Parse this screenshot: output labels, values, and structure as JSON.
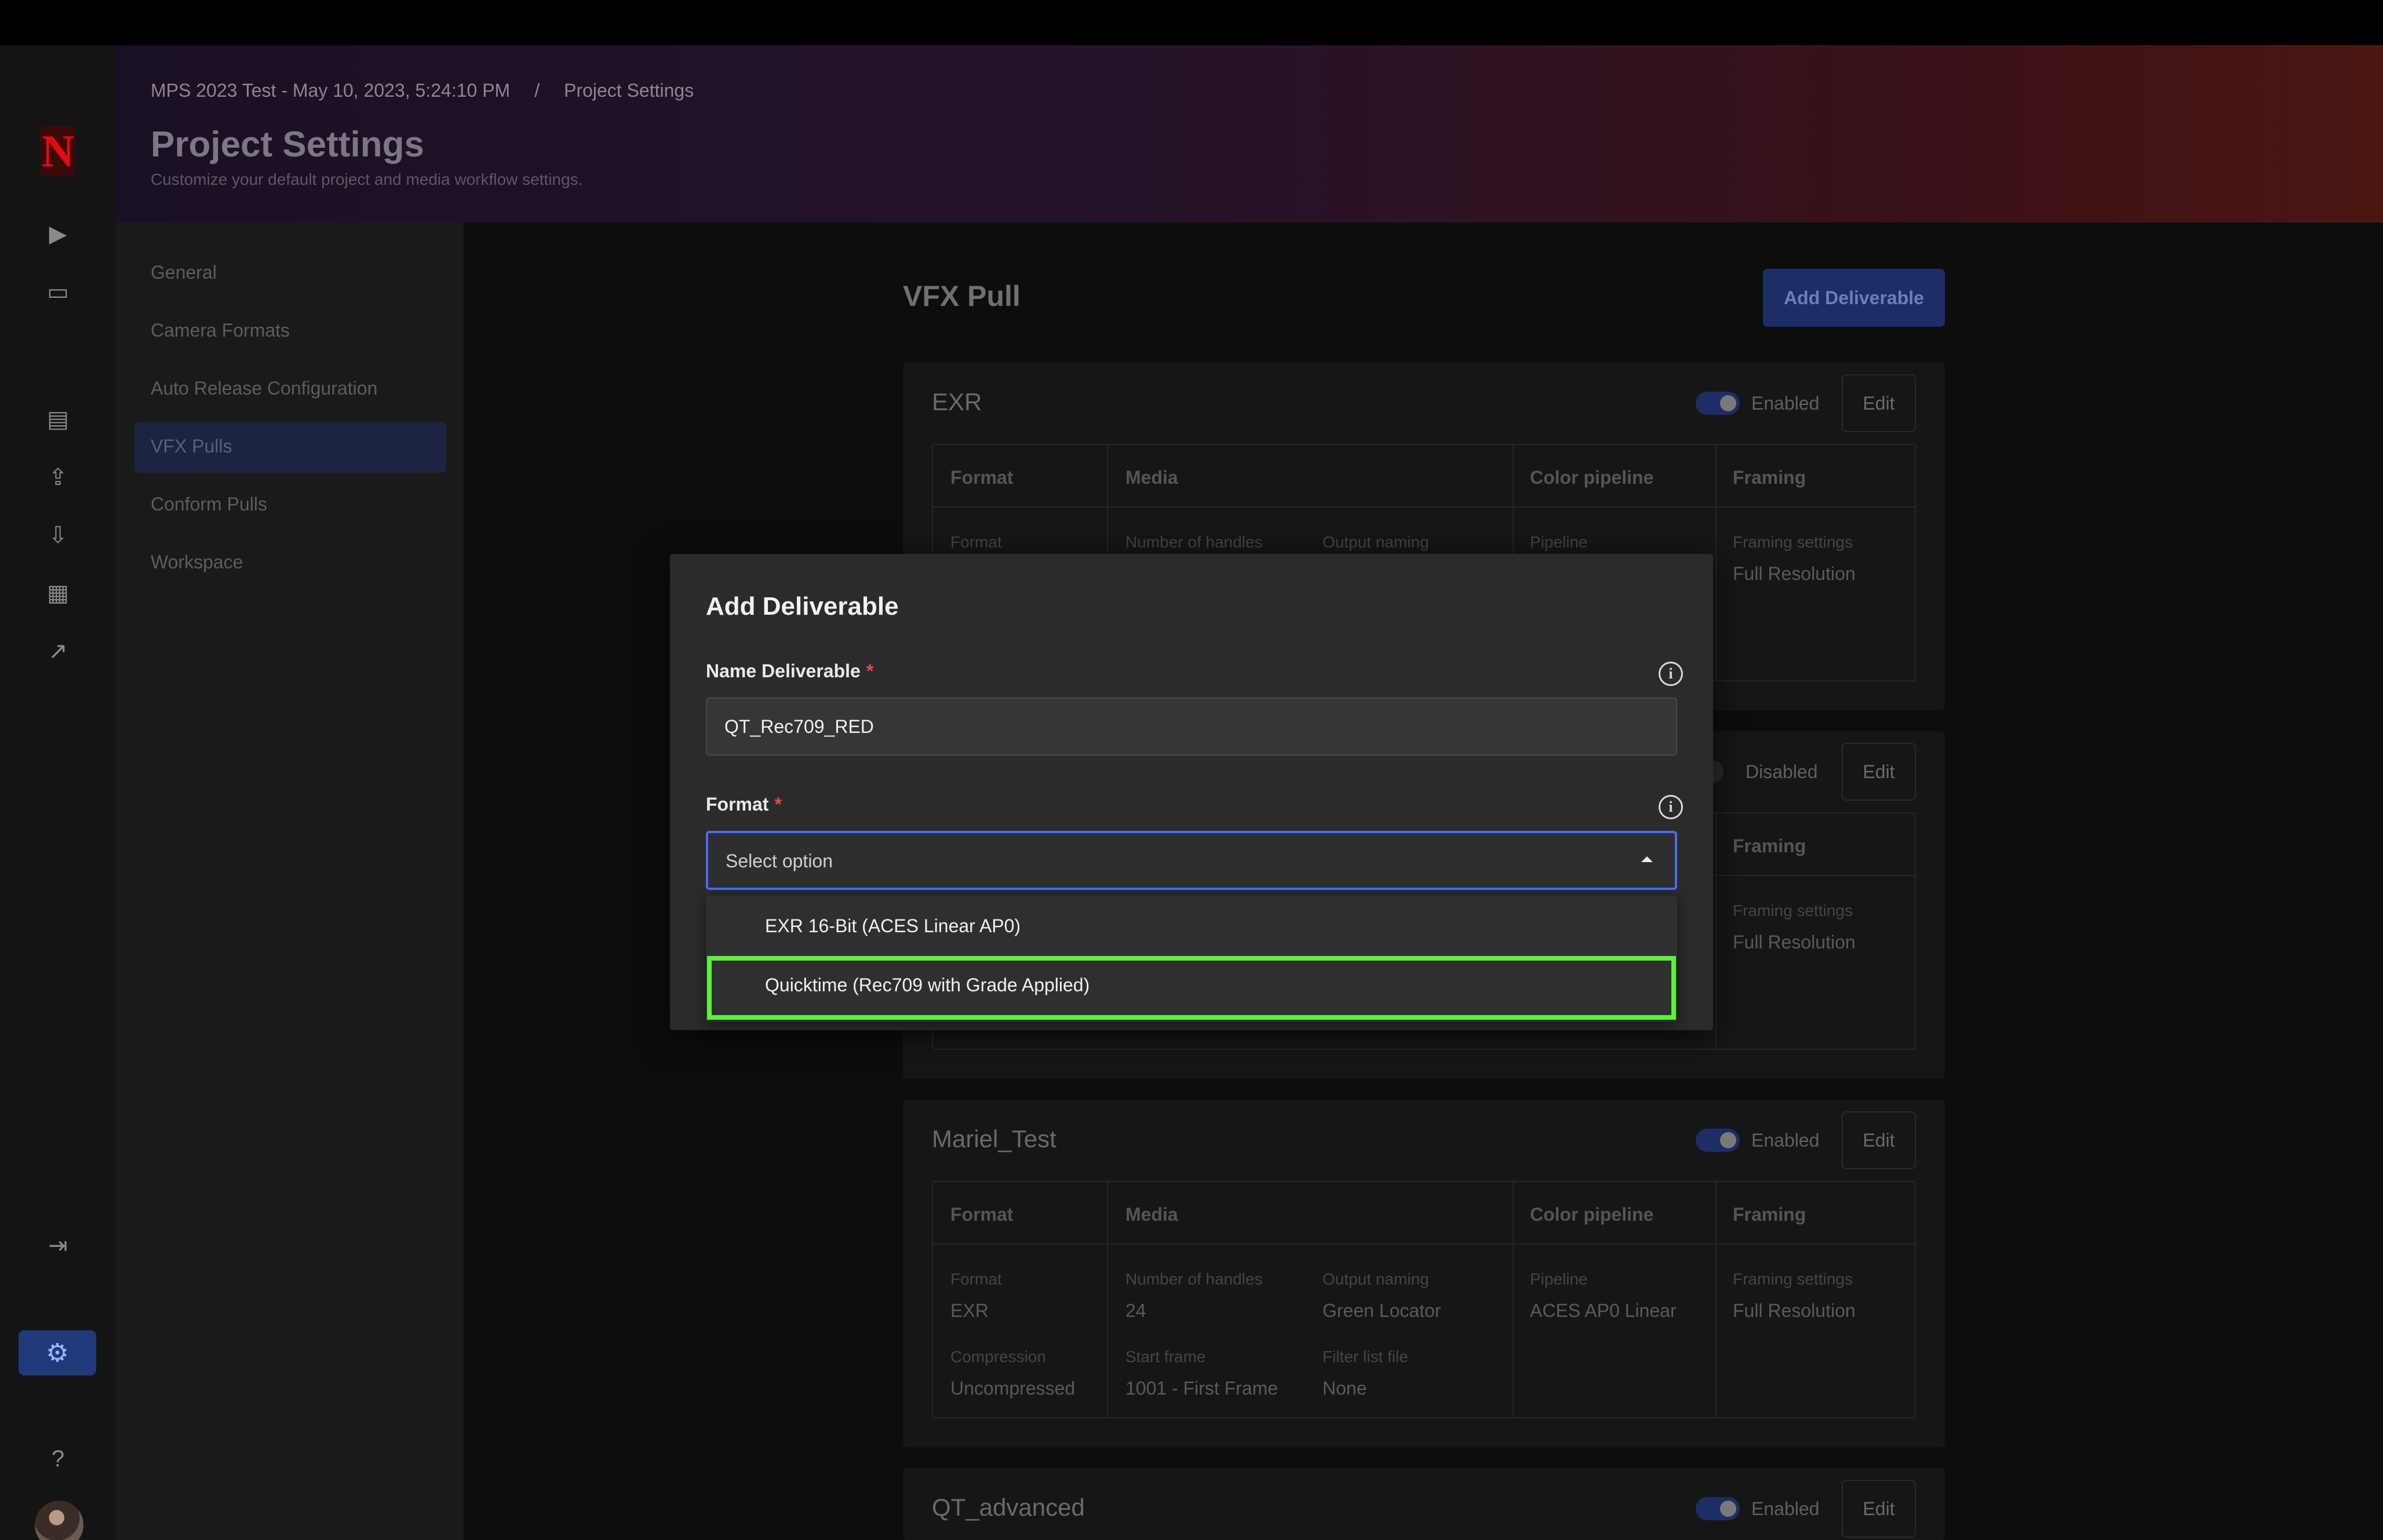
{
  "breadcrumb": {
    "project": "MPS 2023 Test - May 10, 2023, 5:24:10 PM",
    "separator": "/",
    "current": "Project Settings"
  },
  "page": {
    "title": "Project Settings",
    "subtitle": "Customize your default project and media workflow settings."
  },
  "rail": {
    "logo": "N",
    "icons": [
      "play-icon",
      "folder-icon",
      "film-icon",
      "upload-icon",
      "download-icon",
      "calendar-icon",
      "arrow-icon",
      "collapse-icon",
      "gear-icon",
      "help-icon"
    ]
  },
  "settings_nav": {
    "items": [
      "General",
      "Camera Formats",
      "Auto Release Configuration",
      "VFX Pulls",
      "Conform Pulls",
      "Workspace"
    ],
    "active": "VFX Pulls"
  },
  "content": {
    "section_title": "VFX Pull",
    "add_button": "Add Deliverable",
    "columns": [
      "Format",
      "Media",
      "Color pipeline",
      "Framing"
    ],
    "cards": [
      {
        "name": "EXR",
        "status": "Enabled",
        "edit": "Edit",
        "labels": {
          "format": "Format",
          "handles": "Number of handles",
          "naming": "Output naming",
          "pipeline": "Pipeline",
          "framing": "Framing settings"
        },
        "framing_value": "Full Resolution"
      },
      {
        "name": "",
        "status": "Disabled",
        "edit": "Edit",
        "labels": {
          "framing": "Framing settings"
        },
        "framing_value": "Full Resolution"
      },
      {
        "name": "Mariel_Test",
        "status": "Enabled",
        "edit": "Edit",
        "labels": {
          "format": "Format",
          "handles": "Number of handles",
          "naming": "Output naming",
          "pipeline": "Pipeline",
          "framing": "Framing settings",
          "compression": "Compression",
          "start": "Start frame",
          "filter": "Filter list file"
        },
        "values": {
          "format": "EXR",
          "handles": "24",
          "naming": "Green Locator",
          "pipeline": "ACES AP0 Linear",
          "framing": "Full Resolution",
          "compression": "Uncompressed",
          "start": "1001 - First Frame",
          "filter": "None"
        }
      },
      {
        "name": "QT_advanced",
        "status": "Enabled",
        "edit": "Edit"
      }
    ]
  },
  "modal": {
    "title": "Add Deliverable",
    "name_label": "Name Deliverable",
    "required_mark": "*",
    "name_value": "QT_Rec709_RED",
    "format_label": "Format",
    "format_placeholder": "Select option",
    "options": [
      "EXR 16-Bit (ACES Linear AP0)",
      "Quicktime (Rec709 with Grade Applied)"
    ],
    "highlighted_option": "Quicktime (Rec709 with Grade Applied)",
    "highlight_color": "#5ef03a",
    "focus_color": "#4a6cf0"
  }
}
